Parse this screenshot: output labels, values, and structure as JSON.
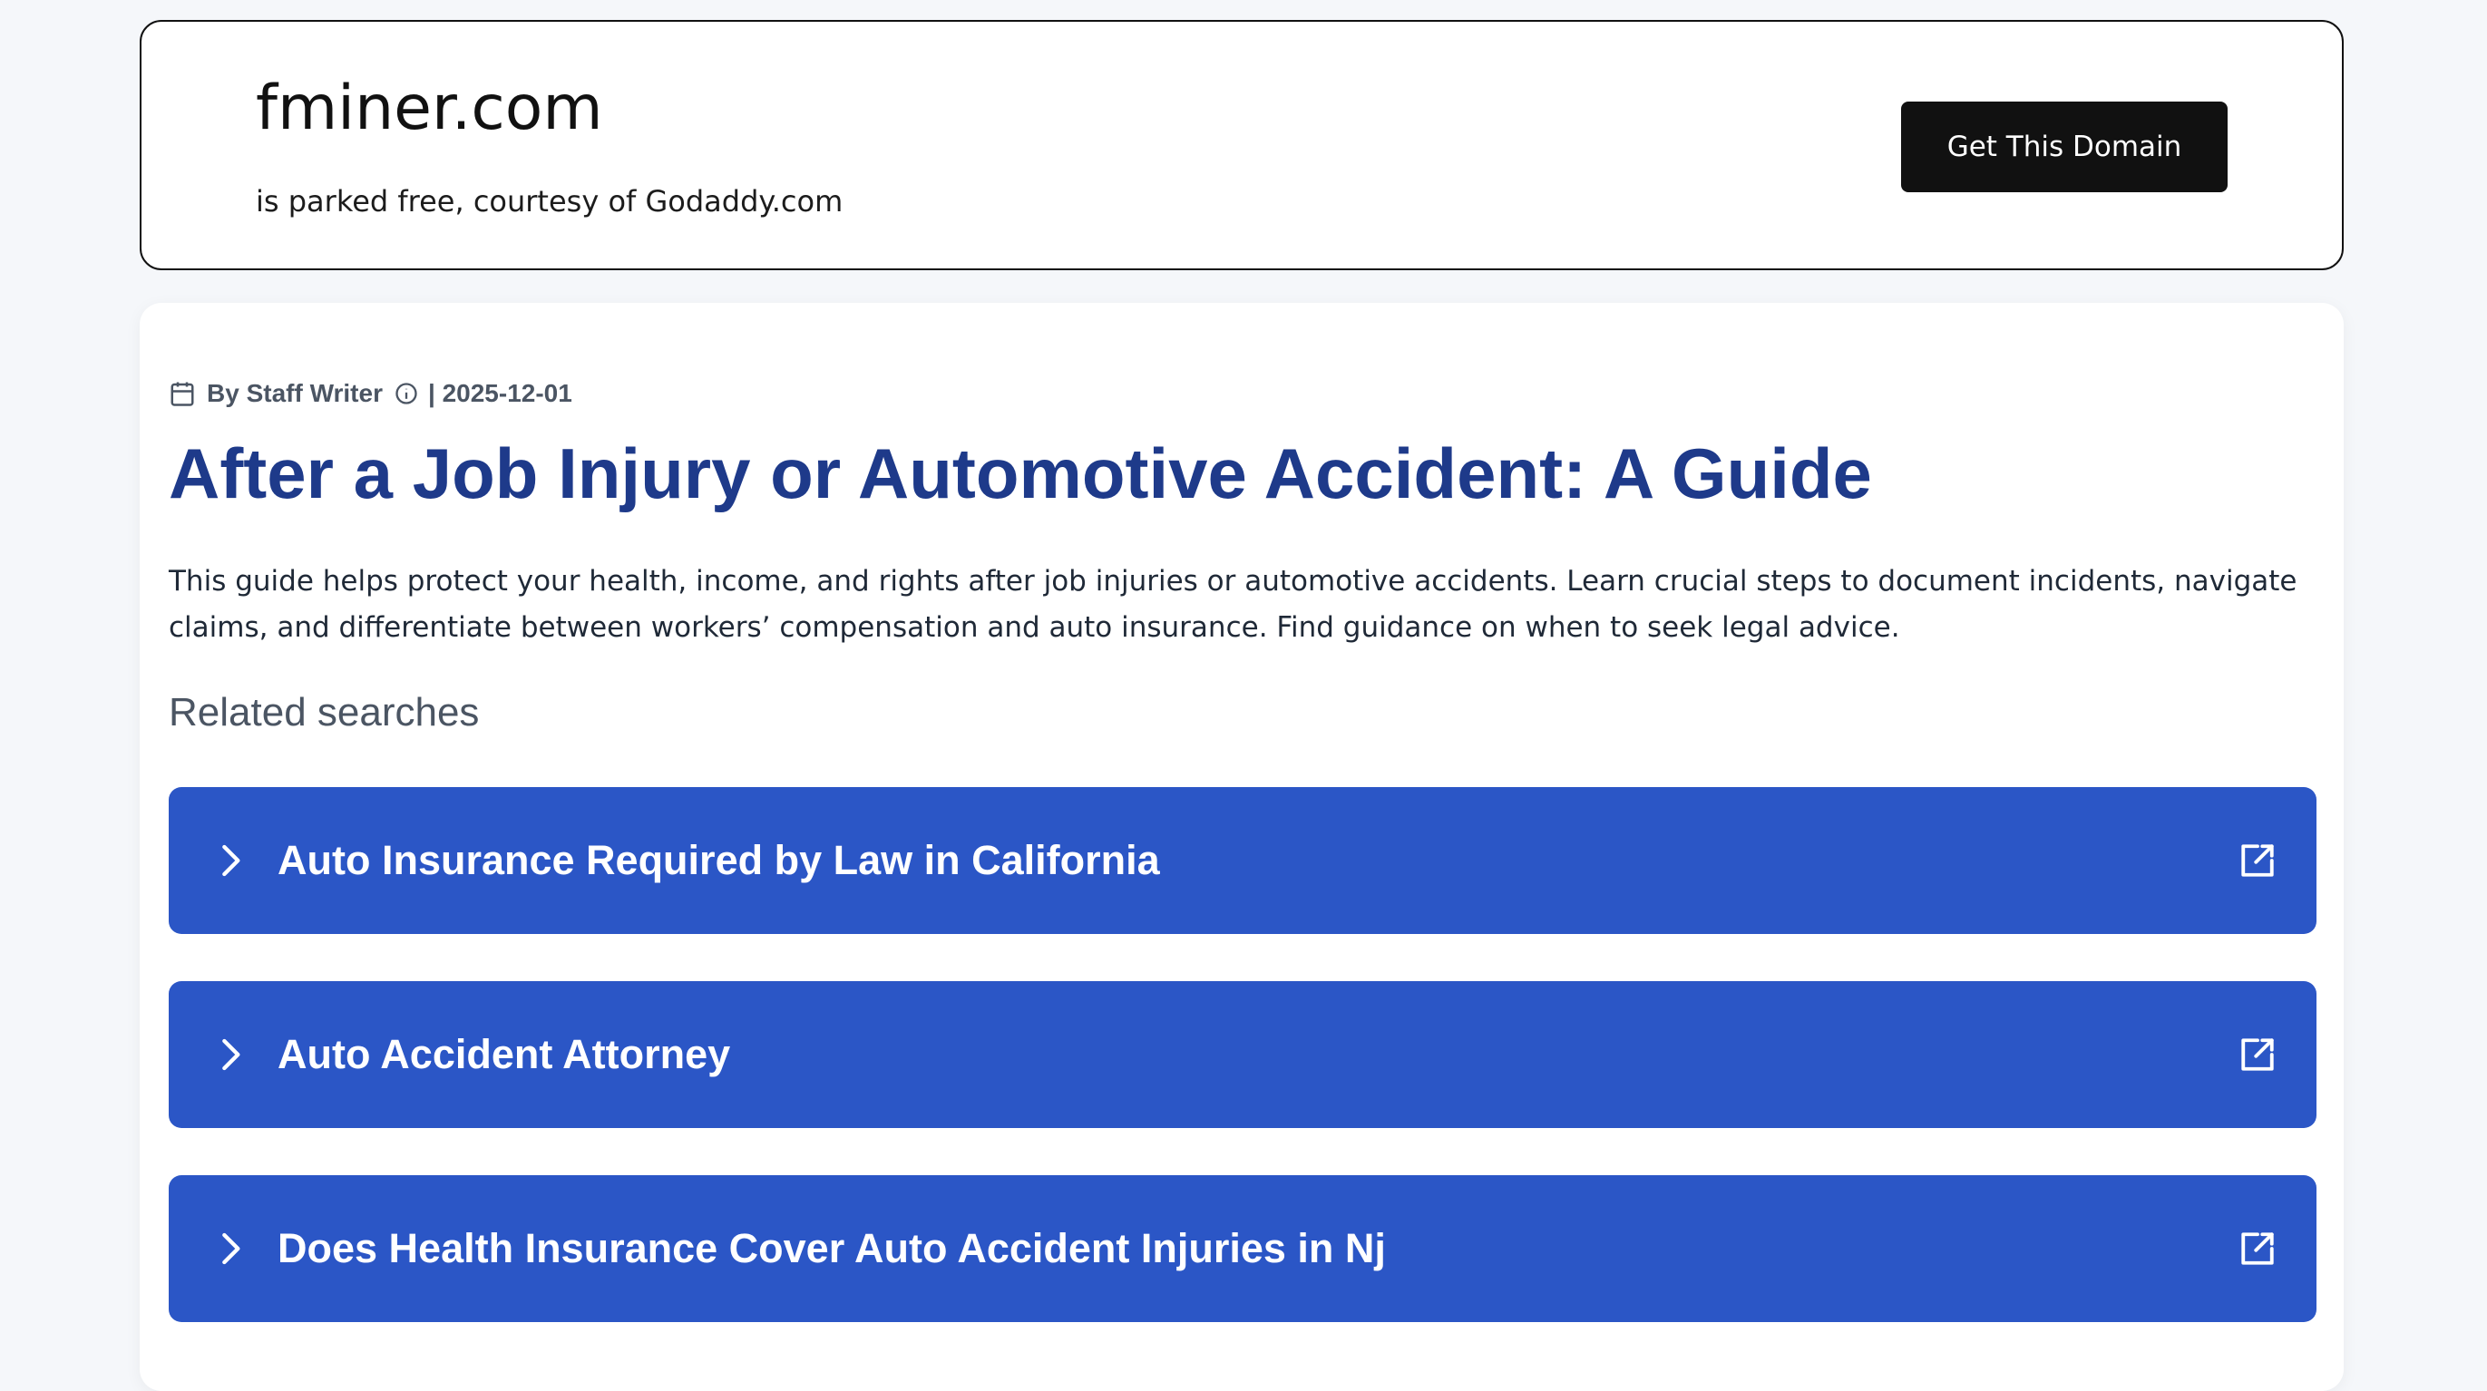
{
  "header": {
    "domain": "fminer.com",
    "subtitle": "is parked free, courtesy of Godaddy.com",
    "cta_label": "Get This Domain"
  },
  "article": {
    "byline": "By Staff Writer",
    "date": "| 2025-12-01",
    "title": "After a Job Injury or Automotive Accident: A Guide",
    "summary": "This guide helps protect your health, income, and rights after job injuries or automotive accidents. Learn crucial steps to document incidents, navigate claims, and differentiate between workers’ compensation and auto insurance. Find guidance on when to seek legal advice."
  },
  "related": {
    "heading": "Related searches",
    "items": [
      {
        "label": "Auto Insurance Required by Law in California",
        "icon_left": "chevron-right-icon",
        "icon_right": "external-link-icon"
      },
      {
        "label": "Auto Accident Attorney",
        "icon_left": "chevron-right-icon",
        "icon_right": "external-link-icon"
      },
      {
        "label": "Does Health Insurance Cover Auto Accident Injuries in Nj",
        "icon_left": "chevron-right-icon",
        "icon_right": "external-link-icon"
      }
    ]
  },
  "colors": {
    "page_background": "#f5f7fa",
    "title_blue": "#1e3a8a",
    "search_button_blue": "#2b56c6",
    "cta_black": "#111111"
  }
}
